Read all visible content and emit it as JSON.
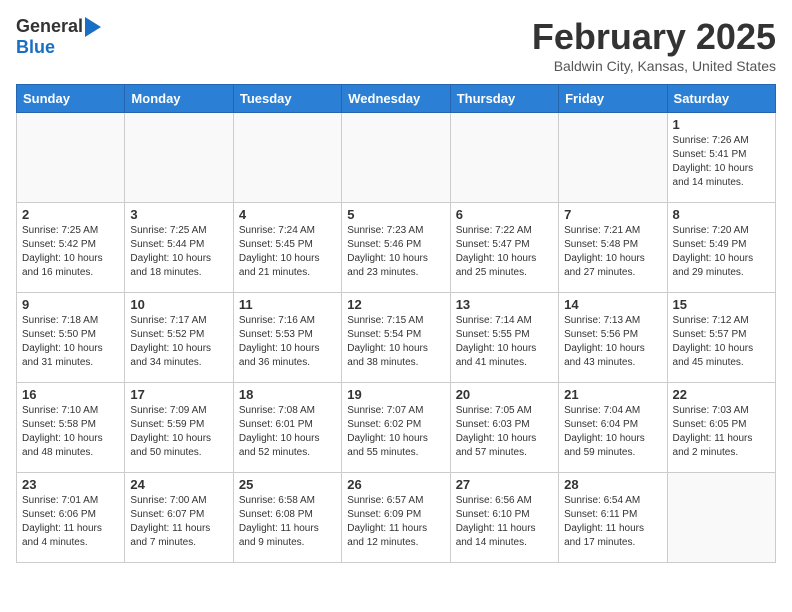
{
  "logo": {
    "general": "General",
    "blue": "Blue"
  },
  "header": {
    "month": "February 2025",
    "location": "Baldwin City, Kansas, United States"
  },
  "days_of_week": [
    "Sunday",
    "Monday",
    "Tuesday",
    "Wednesday",
    "Thursday",
    "Friday",
    "Saturday"
  ],
  "weeks": [
    [
      {
        "day": "",
        "info": ""
      },
      {
        "day": "",
        "info": ""
      },
      {
        "day": "",
        "info": ""
      },
      {
        "day": "",
        "info": ""
      },
      {
        "day": "",
        "info": ""
      },
      {
        "day": "",
        "info": ""
      },
      {
        "day": "1",
        "info": "Sunrise: 7:26 AM\nSunset: 5:41 PM\nDaylight: 10 hours and 14 minutes."
      }
    ],
    [
      {
        "day": "2",
        "info": "Sunrise: 7:25 AM\nSunset: 5:42 PM\nDaylight: 10 hours and 16 minutes."
      },
      {
        "day": "3",
        "info": "Sunrise: 7:25 AM\nSunset: 5:44 PM\nDaylight: 10 hours and 18 minutes."
      },
      {
        "day": "4",
        "info": "Sunrise: 7:24 AM\nSunset: 5:45 PM\nDaylight: 10 hours and 21 minutes."
      },
      {
        "day": "5",
        "info": "Sunrise: 7:23 AM\nSunset: 5:46 PM\nDaylight: 10 hours and 23 minutes."
      },
      {
        "day": "6",
        "info": "Sunrise: 7:22 AM\nSunset: 5:47 PM\nDaylight: 10 hours and 25 minutes."
      },
      {
        "day": "7",
        "info": "Sunrise: 7:21 AM\nSunset: 5:48 PM\nDaylight: 10 hours and 27 minutes."
      },
      {
        "day": "8",
        "info": "Sunrise: 7:20 AM\nSunset: 5:49 PM\nDaylight: 10 hours and 29 minutes."
      }
    ],
    [
      {
        "day": "9",
        "info": "Sunrise: 7:18 AM\nSunset: 5:50 PM\nDaylight: 10 hours and 31 minutes."
      },
      {
        "day": "10",
        "info": "Sunrise: 7:17 AM\nSunset: 5:52 PM\nDaylight: 10 hours and 34 minutes."
      },
      {
        "day": "11",
        "info": "Sunrise: 7:16 AM\nSunset: 5:53 PM\nDaylight: 10 hours and 36 minutes."
      },
      {
        "day": "12",
        "info": "Sunrise: 7:15 AM\nSunset: 5:54 PM\nDaylight: 10 hours and 38 minutes."
      },
      {
        "day": "13",
        "info": "Sunrise: 7:14 AM\nSunset: 5:55 PM\nDaylight: 10 hours and 41 minutes."
      },
      {
        "day": "14",
        "info": "Sunrise: 7:13 AM\nSunset: 5:56 PM\nDaylight: 10 hours and 43 minutes."
      },
      {
        "day": "15",
        "info": "Sunrise: 7:12 AM\nSunset: 5:57 PM\nDaylight: 10 hours and 45 minutes."
      }
    ],
    [
      {
        "day": "16",
        "info": "Sunrise: 7:10 AM\nSunset: 5:58 PM\nDaylight: 10 hours and 48 minutes."
      },
      {
        "day": "17",
        "info": "Sunrise: 7:09 AM\nSunset: 5:59 PM\nDaylight: 10 hours and 50 minutes."
      },
      {
        "day": "18",
        "info": "Sunrise: 7:08 AM\nSunset: 6:01 PM\nDaylight: 10 hours and 52 minutes."
      },
      {
        "day": "19",
        "info": "Sunrise: 7:07 AM\nSunset: 6:02 PM\nDaylight: 10 hours and 55 minutes."
      },
      {
        "day": "20",
        "info": "Sunrise: 7:05 AM\nSunset: 6:03 PM\nDaylight: 10 hours and 57 minutes."
      },
      {
        "day": "21",
        "info": "Sunrise: 7:04 AM\nSunset: 6:04 PM\nDaylight: 10 hours and 59 minutes."
      },
      {
        "day": "22",
        "info": "Sunrise: 7:03 AM\nSunset: 6:05 PM\nDaylight: 11 hours and 2 minutes."
      }
    ],
    [
      {
        "day": "23",
        "info": "Sunrise: 7:01 AM\nSunset: 6:06 PM\nDaylight: 11 hours and 4 minutes."
      },
      {
        "day": "24",
        "info": "Sunrise: 7:00 AM\nSunset: 6:07 PM\nDaylight: 11 hours and 7 minutes."
      },
      {
        "day": "25",
        "info": "Sunrise: 6:58 AM\nSunset: 6:08 PM\nDaylight: 11 hours and 9 minutes."
      },
      {
        "day": "26",
        "info": "Sunrise: 6:57 AM\nSunset: 6:09 PM\nDaylight: 11 hours and 12 minutes."
      },
      {
        "day": "27",
        "info": "Sunrise: 6:56 AM\nSunset: 6:10 PM\nDaylight: 11 hours and 14 minutes."
      },
      {
        "day": "28",
        "info": "Sunrise: 6:54 AM\nSunset: 6:11 PM\nDaylight: 11 hours and 17 minutes."
      },
      {
        "day": "",
        "info": ""
      }
    ]
  ]
}
